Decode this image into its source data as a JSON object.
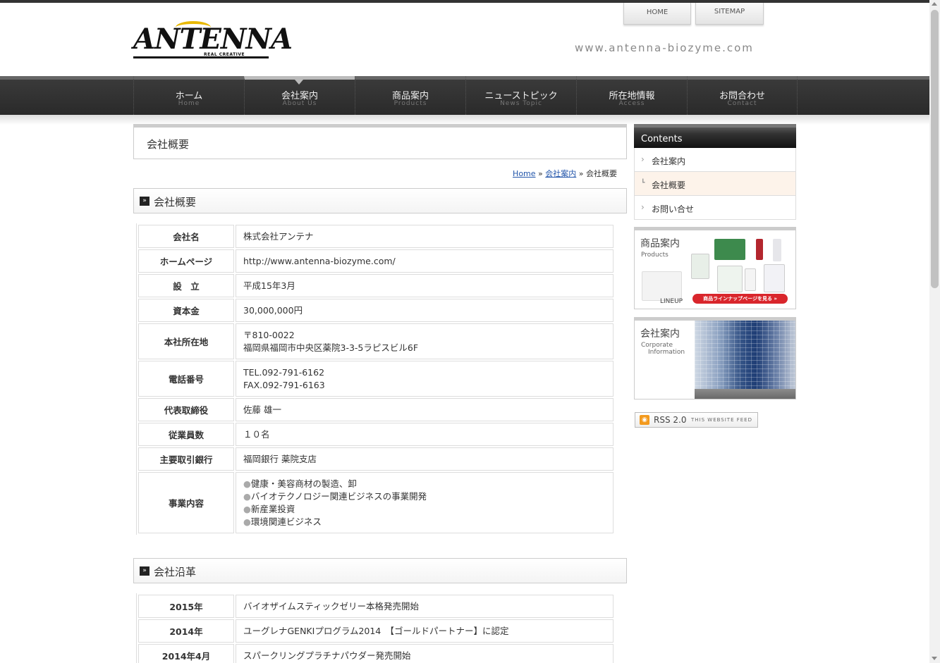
{
  "header": {
    "logo_text": "ANTENNA",
    "logo_sub": "REAL CREATIVE",
    "home_button": "HOME",
    "sitemap_button": "SITEMAP",
    "site_url": "www.antenna-biozyme.com"
  },
  "nav": [
    {
      "ja": "ホーム",
      "en": "Home"
    },
    {
      "ja": "会社案内",
      "en": "About Us"
    },
    {
      "ja": "商品案内",
      "en": "Products"
    },
    {
      "ja": "ニューストピック",
      "en": "News Topic"
    },
    {
      "ja": "所在地情報",
      "en": "Access"
    },
    {
      "ja": "お問合わせ",
      "en": "Contact"
    }
  ],
  "main": {
    "page_title": "会社概要",
    "breadcrumb": {
      "home": "Home",
      "sep": "»",
      "parent": "会社案内",
      "current": "会社概要"
    },
    "section1_title": "会社概要",
    "section1_icon": "double-chevron-icon",
    "profile": [
      {
        "h": "会社名",
        "v": "株式会社アンテナ"
      },
      {
        "h": "ホームページ",
        "v": "http://www.antenna-biozyme.com/"
      },
      {
        "h": "設　立",
        "v": "平成15年3月"
      },
      {
        "h": "資本金",
        "v": "30,000,000円"
      },
      {
        "h": "本社所在地",
        "v1": "〒810-0022",
        "v2": "福岡県福岡市中央区薬院3-3-5ラピスビル6F"
      },
      {
        "h": "電話番号",
        "v1": "TEL.092-791-6162",
        "v2": "FAX.092-791-6163"
      },
      {
        "h": "代表取締役",
        "v": "佐藤 雄一"
      },
      {
        "h": "従業員数",
        "v": "１０名"
      },
      {
        "h": "主要取引銀行",
        "v": "福岡銀行 薬院支店"
      },
      {
        "h": "事業内容",
        "items": [
          "健康・美容商材の製造、卸",
          "バイオテクノロジー関連ビジネスの事業開発",
          "新産業投資",
          "環境関連ビジネス"
        ]
      }
    ],
    "section2_title": "会社沿革",
    "history": [
      {
        "h": "2015年",
        "v": "バイオザイムスティックゼリー本格発売開始"
      },
      {
        "h": "2014年",
        "v": "ユーグレナGENKIプログラム2014　【ゴールドパートナー】に認定"
      },
      {
        "h": "2014年4月",
        "v": "スパークリングプラチナパウダー発売開始"
      }
    ]
  },
  "sidebar": {
    "head": "Contents",
    "items": [
      {
        "label": "会社案内",
        "selected": false
      },
      {
        "label": "会社概要",
        "selected": true
      },
      {
        "label": "お問い合せ",
        "selected": false
      }
    ],
    "banner_products": {
      "title": "商品案内",
      "sub": "Products",
      "lineup": "LINEUP",
      "button": "商品ラインナップページを見る »"
    },
    "banner_company": {
      "title": "会社案内",
      "sub1": "Corporate",
      "sub2": "Information"
    },
    "rss": {
      "label": "RSS 2.0",
      "sub": "THIS WEBSITE FEED"
    }
  },
  "colors": {
    "nav_bg": "#2f2f2f",
    "selected_bg": "#fdf3ea",
    "link": "#2255aa",
    "rss": "#f39a1e"
  }
}
